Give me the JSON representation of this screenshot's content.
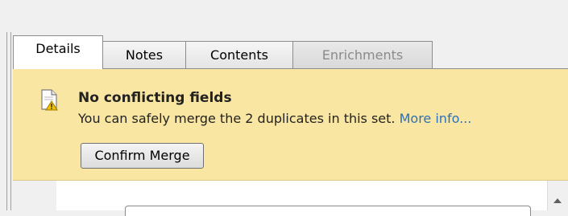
{
  "tabs": [
    {
      "label": "Details",
      "state": "active"
    },
    {
      "label": "Notes",
      "state": "normal"
    },
    {
      "label": "Contents",
      "state": "normal"
    },
    {
      "label": "Enrichments",
      "state": "disabled"
    }
  ],
  "banner": {
    "icon": "document-warning-icon",
    "title": "No conflicting fields",
    "message": "You can safely merge the 2 duplicates in this set.",
    "link": "More info...",
    "button": "Confirm Merge"
  },
  "colors": {
    "banner_bg": "#f9e6a3",
    "link": "#2f6fb7",
    "disabled_text": "#8a8a8a"
  }
}
